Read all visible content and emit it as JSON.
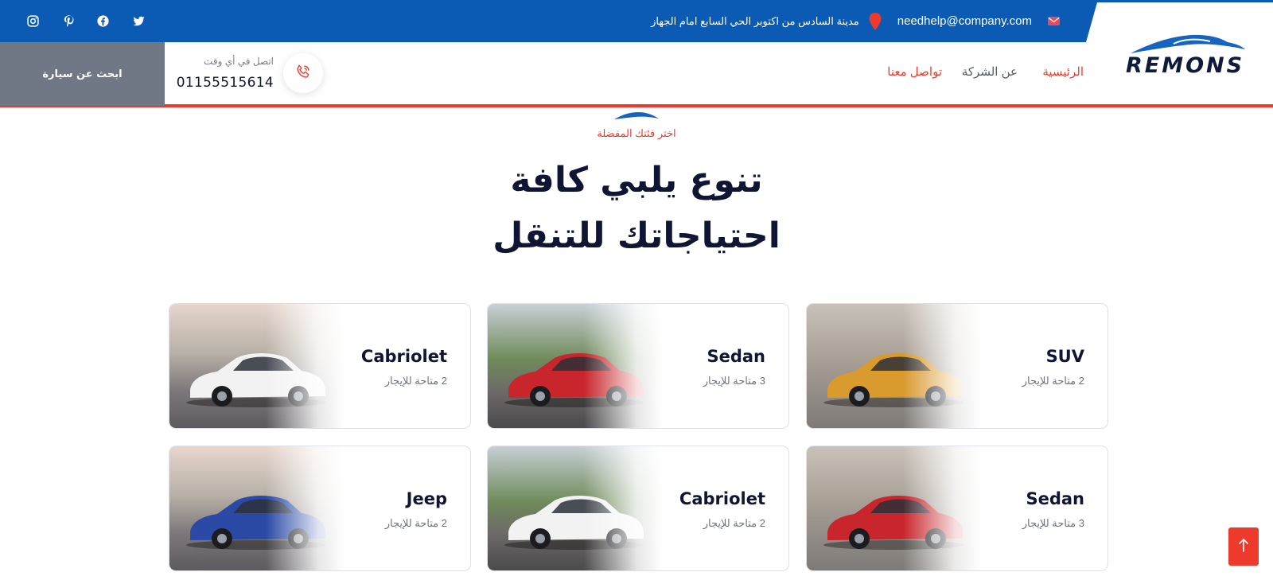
{
  "topbar": {
    "address": "مدينة السادس من اكتوبر الحي السابع امام الجهاز",
    "email": "needhelp@company.com",
    "social": [
      "twitter-icon",
      "facebook-icon",
      "pinterest-icon",
      "instagram-icon"
    ]
  },
  "header": {
    "brand": "REMONS",
    "nav": {
      "home": "الرئيسية",
      "about": "عن الشركة",
      "contact": "تواصل معنا"
    },
    "call_label": "اتصل في أي وقت",
    "phone": "01155515614",
    "search_button": "ابحث عن سيارة"
  },
  "section": {
    "eyebrow": "اختر فئتك المفضلة",
    "headline_line1": "تنوع يلبي كافة",
    "headline_line2": "احتياجاتك للتنقل"
  },
  "cards": [
    {
      "type": "SUV",
      "availability": "2 متاحة للإيجار",
      "car_color": "#d99a2e"
    },
    {
      "type": "Sedan",
      "availability": "3 متاحة للإيجار",
      "car_color": "#c8262c"
    },
    {
      "type": "Cabriolet",
      "availability": "2 متاحة للإيجار",
      "car_color": "#f2f2f2"
    },
    {
      "type": "Sedan",
      "availability": "3 متاحة للإيجار",
      "car_color": "#c8262c"
    },
    {
      "type": "Cabriolet",
      "availability": "2 متاحة للإيجار",
      "car_color": "#f2f2f2"
    },
    {
      "type": "Jeep",
      "availability": "2 متاحة للإيجار",
      "car_color": "#2a4aa6"
    }
  ],
  "colors": {
    "primary_blue": "#0b5bb5",
    "accent_red": "#ee3a2d",
    "dark_text": "#0f1533",
    "search_gray": "#707886"
  }
}
